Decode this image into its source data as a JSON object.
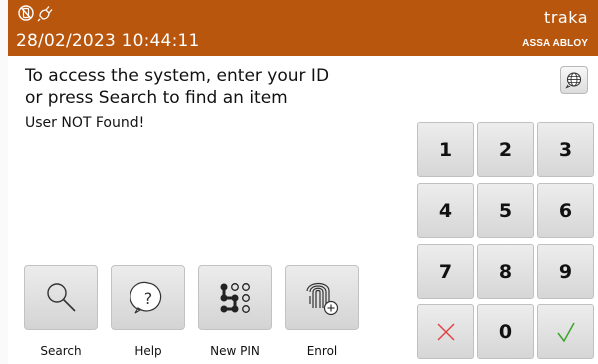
{
  "header": {
    "datetime": "28/02/2023 10:44:11",
    "brand_name": "traka",
    "brand_sub": "ASSA ABLOY",
    "status_icons": [
      "mobile-off-icon",
      "power-plug-icon"
    ],
    "background": "#b8560e"
  },
  "main": {
    "prompt_line1": "To access the system, enter your ID",
    "prompt_line2": "or press Search to find an item",
    "error": "User NOT Found!"
  },
  "language_button": {
    "icon": "globe-icon"
  },
  "keypad": {
    "keys": [
      "1",
      "2",
      "3",
      "4",
      "5",
      "6",
      "7",
      "8",
      "9"
    ],
    "zero": "0",
    "cancel_icon": "cancel-x-icon",
    "confirm_icon": "confirm-check-icon",
    "cancel_color": "#e04040",
    "confirm_color": "#3aa52a"
  },
  "actions": [
    {
      "label": "Search",
      "icon": "search-icon"
    },
    {
      "label": "Help",
      "icon": "help-icon"
    },
    {
      "label": "New PIN",
      "icon": "pin-pattern-icon"
    },
    {
      "label": "Enrol",
      "icon": "fingerprint-add-icon"
    }
  ]
}
